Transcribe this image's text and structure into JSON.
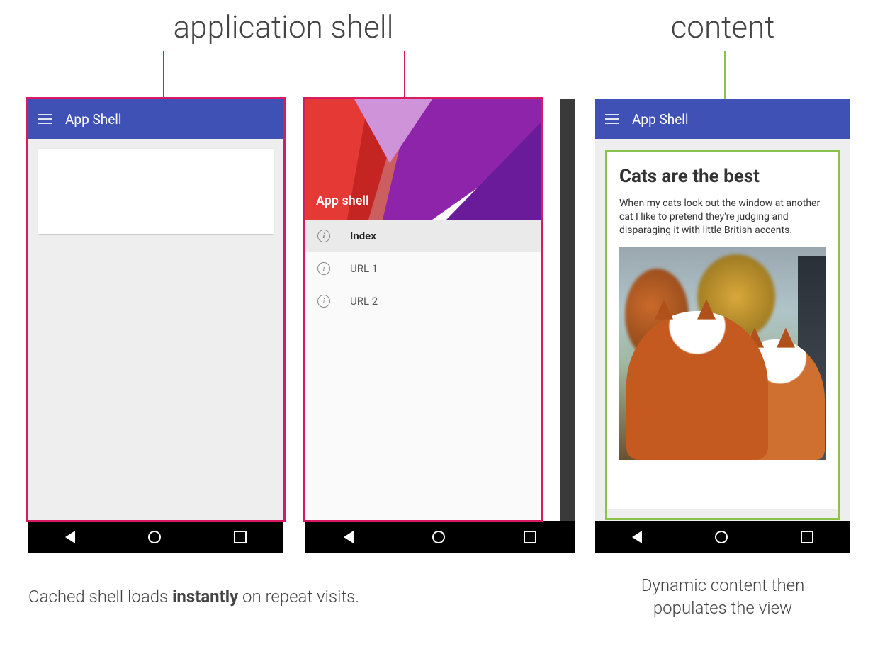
{
  "headings": {
    "app_shell": "application shell",
    "content": "content"
  },
  "appbar": {
    "title": "App Shell",
    "menu_icon": "hamburger-icon"
  },
  "drawer": {
    "header_label": "App shell",
    "items": [
      {
        "label": "Index",
        "selected": true
      },
      {
        "label": "URL 1",
        "selected": false
      },
      {
        "label": "URL 2",
        "selected": false
      }
    ]
  },
  "content_card": {
    "title": "Cats are the best",
    "body": "When my cats look out the window at another cat I like to pretend they're judging and disparaging it with little British accents.",
    "image_alt": "two orange cats looking out a window at autumn trees"
  },
  "android_nav": {
    "back": "back-triangle-icon",
    "home": "home-circle-icon",
    "recent": "recent-square-icon"
  },
  "captions": {
    "left_pre": "Cached shell loads ",
    "left_strong": "instantly",
    "left_post": " on repeat visits.",
    "right": "Dynamic content then populates the view"
  },
  "colors": {
    "appbar": "#3f51b5",
    "outline_pink": "#d81b60",
    "outline_green": "#8bc34a"
  }
}
